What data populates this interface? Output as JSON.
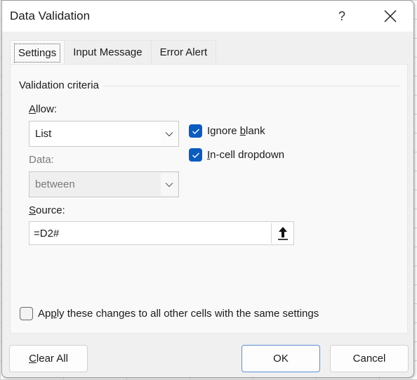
{
  "window": {
    "title": "Data Validation",
    "help_label": "?",
    "close_icon": "close-icon"
  },
  "tabs": [
    {
      "label": "Settings",
      "active": true
    },
    {
      "label": "Input Message",
      "active": false
    },
    {
      "label": "Error Alert",
      "active": false
    }
  ],
  "settings": {
    "group_label": "Validation criteria",
    "allow": {
      "label_accel": "A",
      "label_rest": "llow:",
      "value": "List"
    },
    "data": {
      "label": "Data:",
      "value": "between",
      "disabled": true
    },
    "ignore_blank": {
      "label_pre": "Ignore ",
      "label_accel": "b",
      "label_post": "lank",
      "checked": true
    },
    "in_cell_dropdown": {
      "label_accel": "I",
      "label_post": "n-cell dropdown",
      "checked": true
    },
    "source": {
      "label_accel": "S",
      "label_rest": "ource:",
      "value": "=D2#",
      "ref_icon": "collapse-dialog-arrow-icon"
    },
    "apply_all": {
      "label_pre": "Ap",
      "label_accel": "p",
      "label_post": "ly these changes to all other cells with the same settings",
      "checked": false
    }
  },
  "buttons": {
    "clear_all_accel": "C",
    "clear_all_rest": "lear All",
    "ok": "OK",
    "cancel": "Cancel"
  },
  "colors": {
    "accent": "#0b5cc0",
    "default_button_border": "#5b8fd2"
  }
}
